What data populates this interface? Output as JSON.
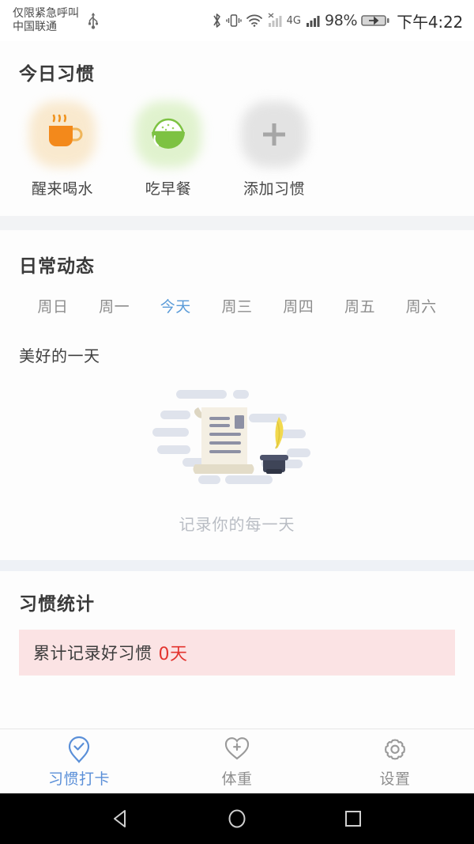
{
  "status_bar": {
    "carrier_line1": "仅限紧急呼叫",
    "carrier_line2": "中国联通",
    "usb_icon": "usb-icon",
    "bluetooth_icon": "bluetooth-icon",
    "vibrate_icon": "vibrate-icon",
    "wifi_icon": "wifi-icon",
    "signal1_icon": "signal-no-service-icon",
    "network_type": "4G",
    "signal2_icon": "signal-bars-icon",
    "battery_percent": "98%",
    "battery_icon": "battery-charging-icon",
    "clock": "下午4:22"
  },
  "habits": {
    "title": "今日习惯",
    "items": [
      {
        "label": "醒来喝水",
        "icon": "cup-of-water-icon",
        "glow": "glow-orange",
        "color": "#f08a1e"
      },
      {
        "label": "吃早餐",
        "icon": "rice-bowl-icon",
        "glow": "glow-green",
        "color": "#7dc242"
      },
      {
        "label": "添加习惯",
        "icon": "plus-icon",
        "glow": "glow-gray",
        "color": "#a8a8a8"
      }
    ]
  },
  "daily": {
    "title": "日常动态",
    "weekdays": [
      {
        "label": "周日",
        "active": false
      },
      {
        "label": "周一",
        "active": false
      },
      {
        "label": "今天",
        "active": true
      },
      {
        "label": "周三",
        "active": false
      },
      {
        "label": "周四",
        "active": false
      },
      {
        "label": "周五",
        "active": false
      },
      {
        "label": "周六",
        "active": false
      }
    ],
    "active_color": "#5a9bd8",
    "mood_text": "美好的一天",
    "empty_caption": "记录你的每一天",
    "empty_illustration": "scroll-and-quill-icon"
  },
  "stats": {
    "title": "习惯统计",
    "banner_text": "累计记录好习惯",
    "banner_count": "0天",
    "banner_bg": "#fbe3e4",
    "count_color": "#e3342f"
  },
  "bottom_nav": {
    "items": [
      {
        "label": "习惯打卡",
        "icon": "pin-check-icon",
        "active": true
      },
      {
        "label": "体重",
        "icon": "heart-plus-icon",
        "active": false
      },
      {
        "label": "设置",
        "icon": "gear-icon",
        "active": false
      }
    ],
    "active_color": "#5a8fd8"
  },
  "android_nav": {
    "back": "back-triangle-icon",
    "home": "home-circle-icon",
    "recents": "recents-square-icon"
  }
}
